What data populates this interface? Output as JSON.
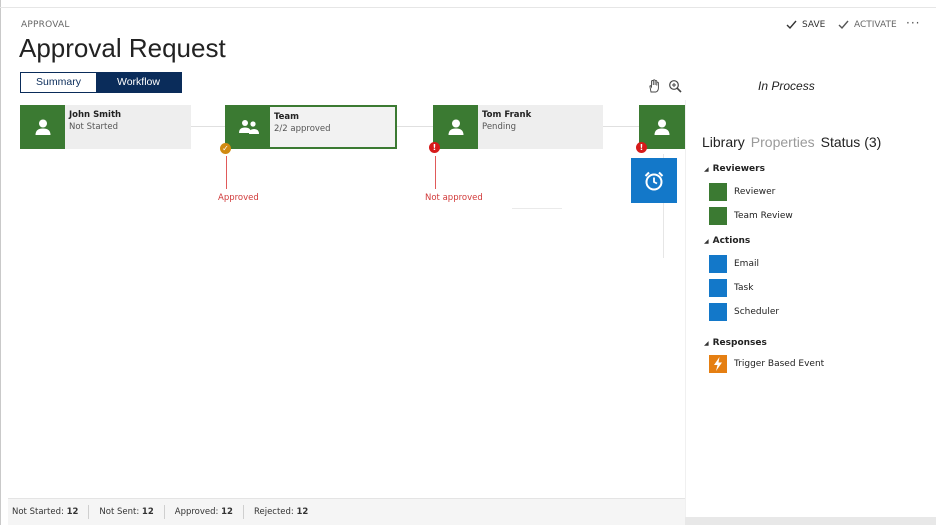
{
  "header": {
    "eyebrow": "APPROVAL",
    "title": "Approval Request",
    "commands": {
      "save": "SAVE",
      "activate": "ACTIVATE",
      "more": "···"
    }
  },
  "tabs": {
    "summary": "Summary",
    "workflow": "Workflow",
    "selected": "Workflow"
  },
  "toolbar": {
    "icons": [
      "hand-icon",
      "zoom-in-icon"
    ]
  },
  "workflow": {
    "nodes": [
      {
        "name": "John Smith",
        "status": "Not Started",
        "icon": "person-icon"
      },
      {
        "name": "Team",
        "status": "2/2 approved",
        "icon": "people-icon",
        "badge": "check"
      },
      {
        "name": "Tom Frank",
        "status": "Pending",
        "icon": "person-icon",
        "badge": "error"
      },
      {
        "icon": "person-icon",
        "badge": "error"
      }
    ],
    "outcomes": {
      "approved": "Approved",
      "not_approved": "Not approved"
    },
    "alarm_icon": "alarm-clock-icon"
  },
  "status_bar": {
    "not_started_label": "Not Started:",
    "not_started": "12",
    "not_sent_label": "Not Sent:",
    "not_sent": "12",
    "approved_label": "Approved:",
    "approved": "12",
    "rejected_label": "Rejected:",
    "rejected": "12"
  },
  "panel": {
    "status_text": "In Process",
    "tabs": {
      "library": "Library",
      "properties": "Properties",
      "status": "Status (3)"
    },
    "sections": {
      "reviewers": {
        "title": "Reviewers",
        "items": [
          "Reviewer",
          "Team Review"
        ]
      },
      "actions": {
        "title": "Actions",
        "items": [
          "Email",
          "Task",
          "Scheduler"
        ]
      },
      "responses": {
        "title": "Responses",
        "items": [
          "Trigger Based Event"
        ]
      }
    }
  },
  "colors": {
    "navy": "#0a2c5a",
    "green": "#3b7a32",
    "blue": "#1378c9",
    "orange": "#e57f12",
    "red": "#d61a1a"
  }
}
